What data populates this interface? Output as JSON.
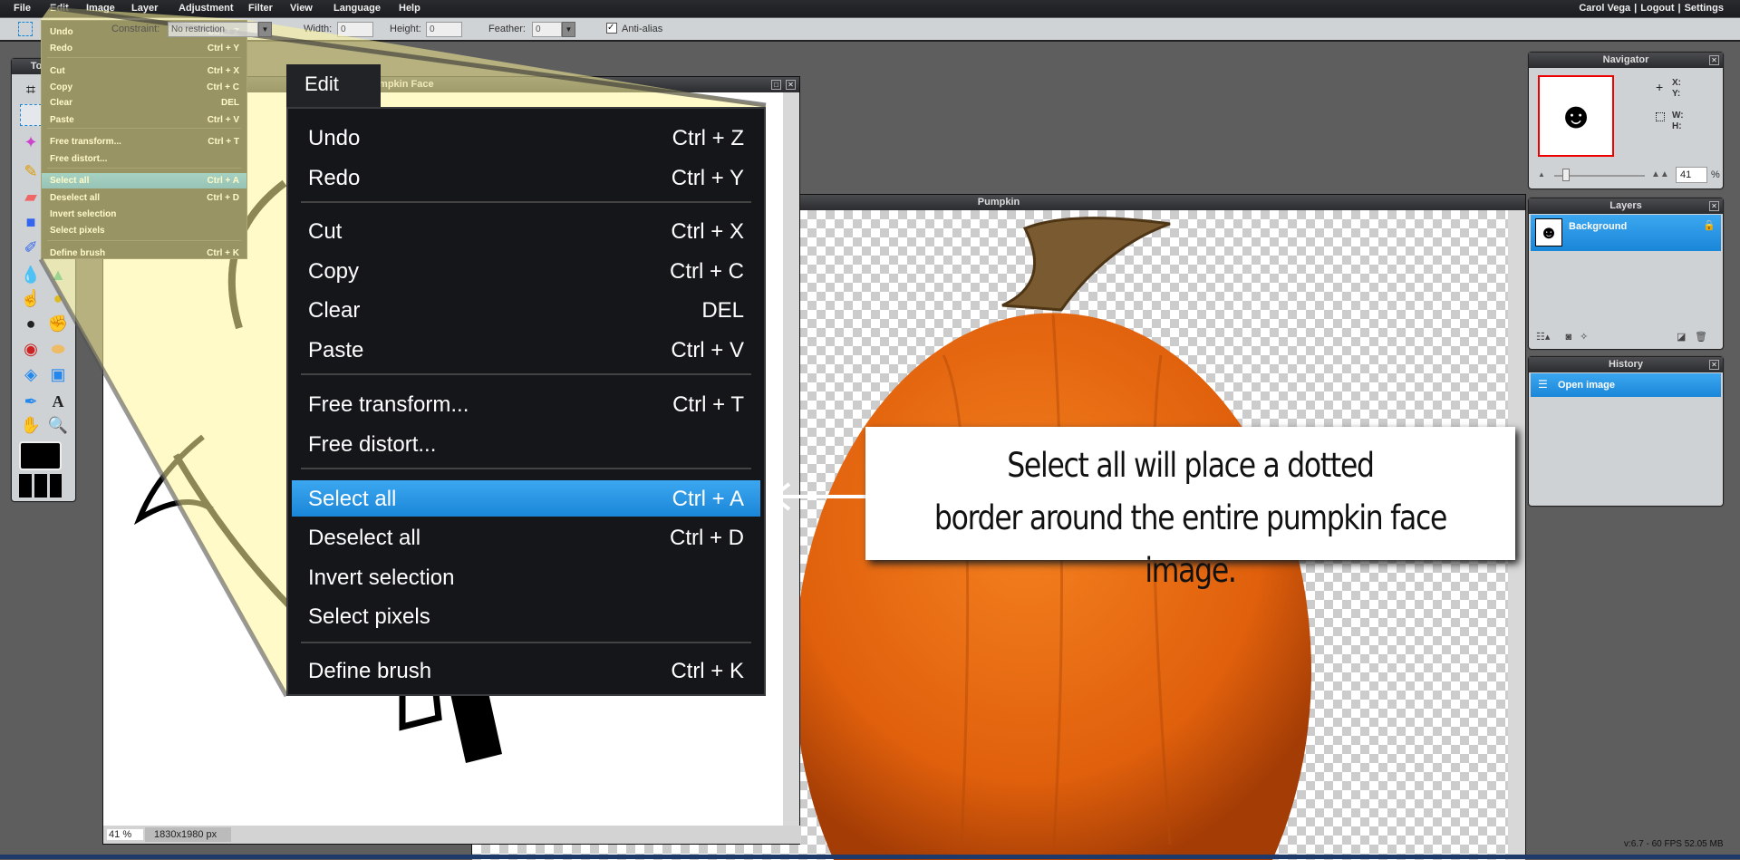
{
  "menubar": {
    "items": [
      "File",
      "Edit",
      "Image",
      "Layer",
      "Adjustment",
      "Filter",
      "View",
      "Language",
      "Help"
    ],
    "user": "Carol Vega",
    "logout": "Logout",
    "settings": "Settings"
  },
  "toolbar": {
    "constraint_label": "Constraint:",
    "constraint_value": "No restriction",
    "width_label": "Width:",
    "width_value": "0",
    "height_label": "Height:",
    "height_value": "0",
    "feather_label": "Feather:",
    "feather_value": "0",
    "antialias_label": "Anti-alias",
    "antialias_checked": true
  },
  "tools_panel": {
    "title": "Tools"
  },
  "edit_menu": {
    "title": "Edit",
    "items": [
      {
        "label": "Undo",
        "shortcut": "Ctrl + Z"
      },
      {
        "label": "Redo",
        "shortcut": "Ctrl + Y"
      },
      {
        "label": "Cut",
        "shortcut": "Ctrl + X"
      },
      {
        "label": "Copy",
        "shortcut": "Ctrl + C"
      },
      {
        "label": "Clear",
        "shortcut": "DEL"
      },
      {
        "label": "Paste",
        "shortcut": "Ctrl + V"
      },
      {
        "label": "Free transform...",
        "shortcut": "Ctrl + T"
      },
      {
        "label": "Free distort...",
        "shortcut": ""
      },
      {
        "label": "Select all",
        "shortcut": "Ctrl + A",
        "selected": true
      },
      {
        "label": "Deselect all",
        "shortcut": "Ctrl + D"
      },
      {
        "label": "Invert selection",
        "shortcut": ""
      },
      {
        "label": "Select pixels",
        "shortcut": ""
      },
      {
        "label": "Define brush",
        "shortcut": "Ctrl + K"
      }
    ]
  },
  "pumpkin_face_window": {
    "title": "Pumpkin Face",
    "zoom": "41",
    "zoom_unit": "%",
    "dimensions": "1830x1980 px"
  },
  "pumpkin_window": {
    "title": "Pumpkin"
  },
  "navigator": {
    "title": "Navigator",
    "x_label": "X:",
    "y_label": "Y:",
    "w_label": "W:",
    "h_label": "H:",
    "zoom": "41",
    "zoom_unit": "%"
  },
  "layers": {
    "title": "Layers",
    "items": [
      {
        "name": "Background",
        "locked": true
      }
    ]
  },
  "history": {
    "title": "History",
    "items": [
      {
        "name": "Open image"
      }
    ]
  },
  "annotation": {
    "line1": "Select all will place a dotted",
    "line2": "border around the entire pumpkin face image."
  },
  "status": {
    "text": "v:6.7 - 60 FPS 52.05 MB"
  },
  "colors": {
    "highlight": "#1a86d8",
    "callout_yellow": "#fff59a",
    "pumpkin": "#e8650f"
  }
}
